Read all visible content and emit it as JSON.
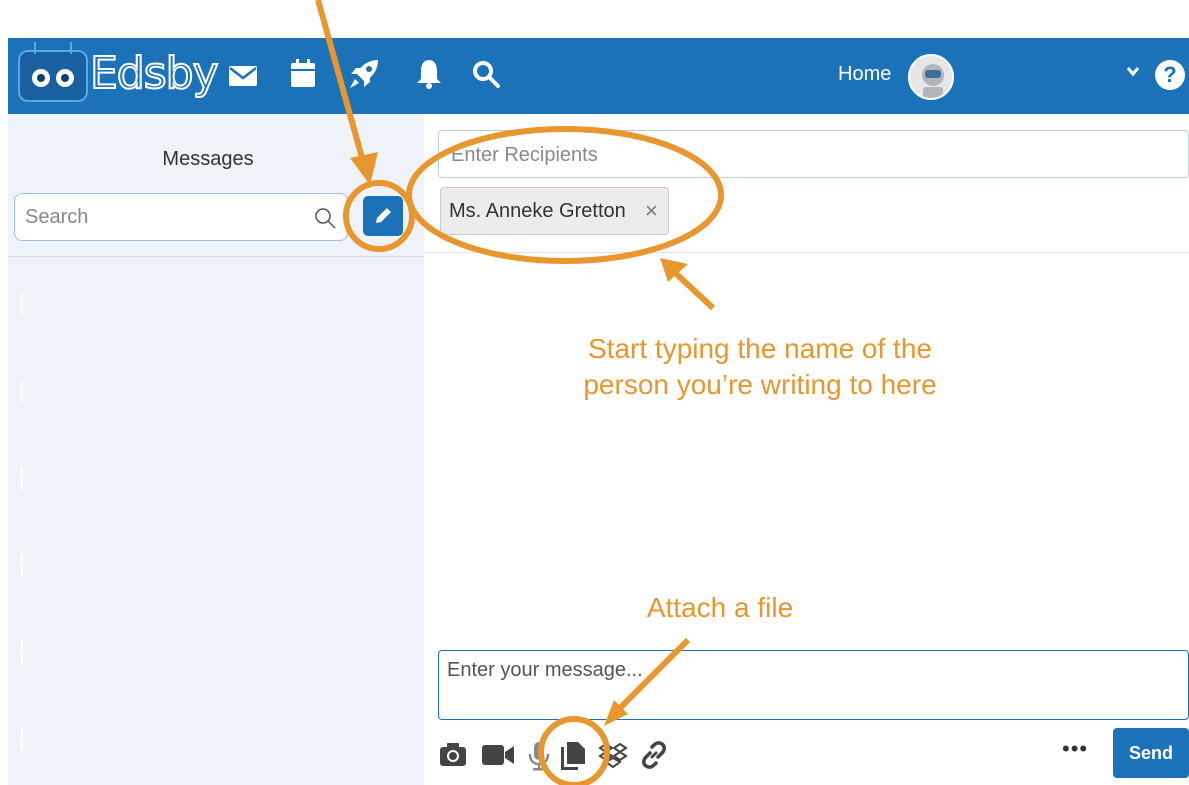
{
  "app": {
    "name": "Edsby",
    "home_label": "Home",
    "help_label": "?",
    "colors": {
      "primary": "#1b72b8",
      "annotation": "#e8962e",
      "sidebar_bg": "#eef3fa"
    }
  },
  "nav_icons": [
    "mail-icon",
    "calendar-icon",
    "rocket-icon",
    "bell-icon",
    "search-icon"
  ],
  "sidebar": {
    "title": "Messages",
    "search_placeholder": "Search"
  },
  "compose": {
    "recipients_placeholder": "Enter Recipients",
    "recipient_chip": "Ms. Anneke Gretton",
    "chip_remove": "×",
    "message_placeholder": "Enter your message...",
    "send_label": "Send",
    "more_label": "•••",
    "toolbar_icons": [
      "camera-icon",
      "video-icon",
      "microphone-icon",
      "file-icon",
      "dropbox-icon",
      "link-icon"
    ]
  },
  "annotations": {
    "recipient_hint_line1": "Start typing the name of the",
    "recipient_hint_line2": "person you’re writing to here",
    "attach_hint": "Attach a file"
  }
}
